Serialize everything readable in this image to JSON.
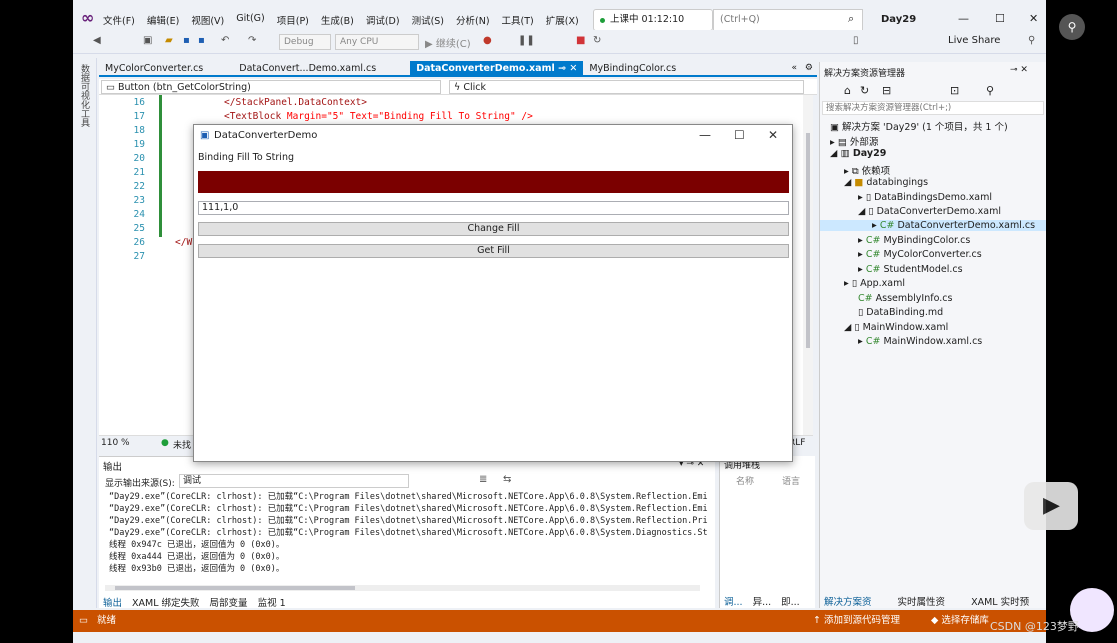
{
  "menu": [
    "文件(F)",
    "编辑(E)",
    "视图(V)",
    "Git(G)",
    "项目(P)",
    "生成(B)",
    "调试(D)",
    "测试(S)",
    "分析(N)",
    "工具(T)",
    "扩展(X)"
  ],
  "live_session": "上课中 01:12:10",
  "search_placeholder": "(Ctrl+Q)",
  "solution_name": "Day29",
  "toolbar": {
    "config": "Debug",
    "platform": "Any CPU",
    "continue": "继续(C)",
    "live_share": "Live Share"
  },
  "left_strip": "数据可视化工具",
  "tabs": [
    "MyColorConverter.cs",
    "DataConvert...Demo.xaml.cs",
    "DataConverterDemo.xaml",
    "MyBindingColor.cs"
  ],
  "nav": {
    "left": "Button (btn_GetColorString)",
    "right": "Click"
  },
  "code": {
    "lines": [
      "16",
      "17",
      "18",
      "19",
      "20",
      "21",
      "22",
      "23",
      "24",
      "25",
      "26",
      "27"
    ],
    "line16": "</StackPanel.DataContext>",
    "line17a": "<TextBlock",
    "line17b": " Margin=\"5\" Text=\"Binding Fill To String\" />",
    "line26": "</W"
  },
  "zoom": "110 %",
  "status_check": "未找",
  "crlf": "RLF",
  "dialog": {
    "title": "DataConverterDemo",
    "label": "Binding Fill To String",
    "fill_color": "#7b0000",
    "textbox": "111,1,0",
    "btn_change": "Change Fill",
    "btn_get": "Get Fill"
  },
  "output": {
    "title": "输出",
    "source_label": "显示输出来源(S):",
    "source_value": "调试",
    "lines": [
      "“Day29.exe”(CoreCLR: clrhost): 已加载“C:\\Program Files\\dotnet\\shared\\Microsoft.NETCore.App\\6.0.8\\System.Reflection.Emi",
      "“Day29.exe”(CoreCLR: clrhost): 已加载“C:\\Program Files\\dotnet\\shared\\Microsoft.NETCore.App\\6.0.8\\System.Reflection.Emi",
      "“Day29.exe”(CoreCLR: clrhost): 已加载“C:\\Program Files\\dotnet\\shared\\Microsoft.NETCore.App\\6.0.8\\System.Reflection.Pri",
      "“Day29.exe”(CoreCLR: clrhost): 已加载“C:\\Program Files\\dotnet\\shared\\Microsoft.NETCore.App\\6.0.8\\System.Diagnostics.St",
      "线程 0x947c 已退出，返回值为 0 (0x0)。",
      "线程 0xa444 已退出，返回值为 0 (0x0)。",
      "线程 0x93b0 已退出，返回值为 0 (0x0)。"
    ],
    "tabs": [
      "输出",
      "XAML 绑定失败",
      "局部变量",
      "监视 1"
    ]
  },
  "callstack": {
    "title": "调用堆栈",
    "col1": "名称",
    "col2": "语言",
    "tabs": [
      "调...",
      "异...",
      "即..."
    ]
  },
  "solution_explorer": {
    "title": "解决方案资源管理器",
    "search": "搜索解决方案资源管理器(Ctrl+;)",
    "items": [
      "解决方案 'Day29' (1 个项目，共 1 个)",
      "外部源",
      "Day29",
      "依赖项",
      "databingings",
      "DataBindingsDemo.xaml",
      "DataConverterDemo.xaml",
      "DataConverterDemo.xaml.cs",
      "MyBindingColor.cs",
      "MyColorConverter.cs",
      "StudentModel.cs",
      "App.xaml",
      "AssemblyInfo.cs",
      "DataBinding.md",
      "MainWindow.xaml",
      "MainWindow.xaml.cs"
    ],
    "bottom_tabs": [
      "解决方案资源...",
      "实时属性资源...",
      "XAML 实时预览"
    ]
  },
  "statusbar": {
    "ready": "就绪",
    "add_source": "添加到源代码管理",
    "select_repo": "选择存储库"
  },
  "watermark": "CSDN @123梦野"
}
